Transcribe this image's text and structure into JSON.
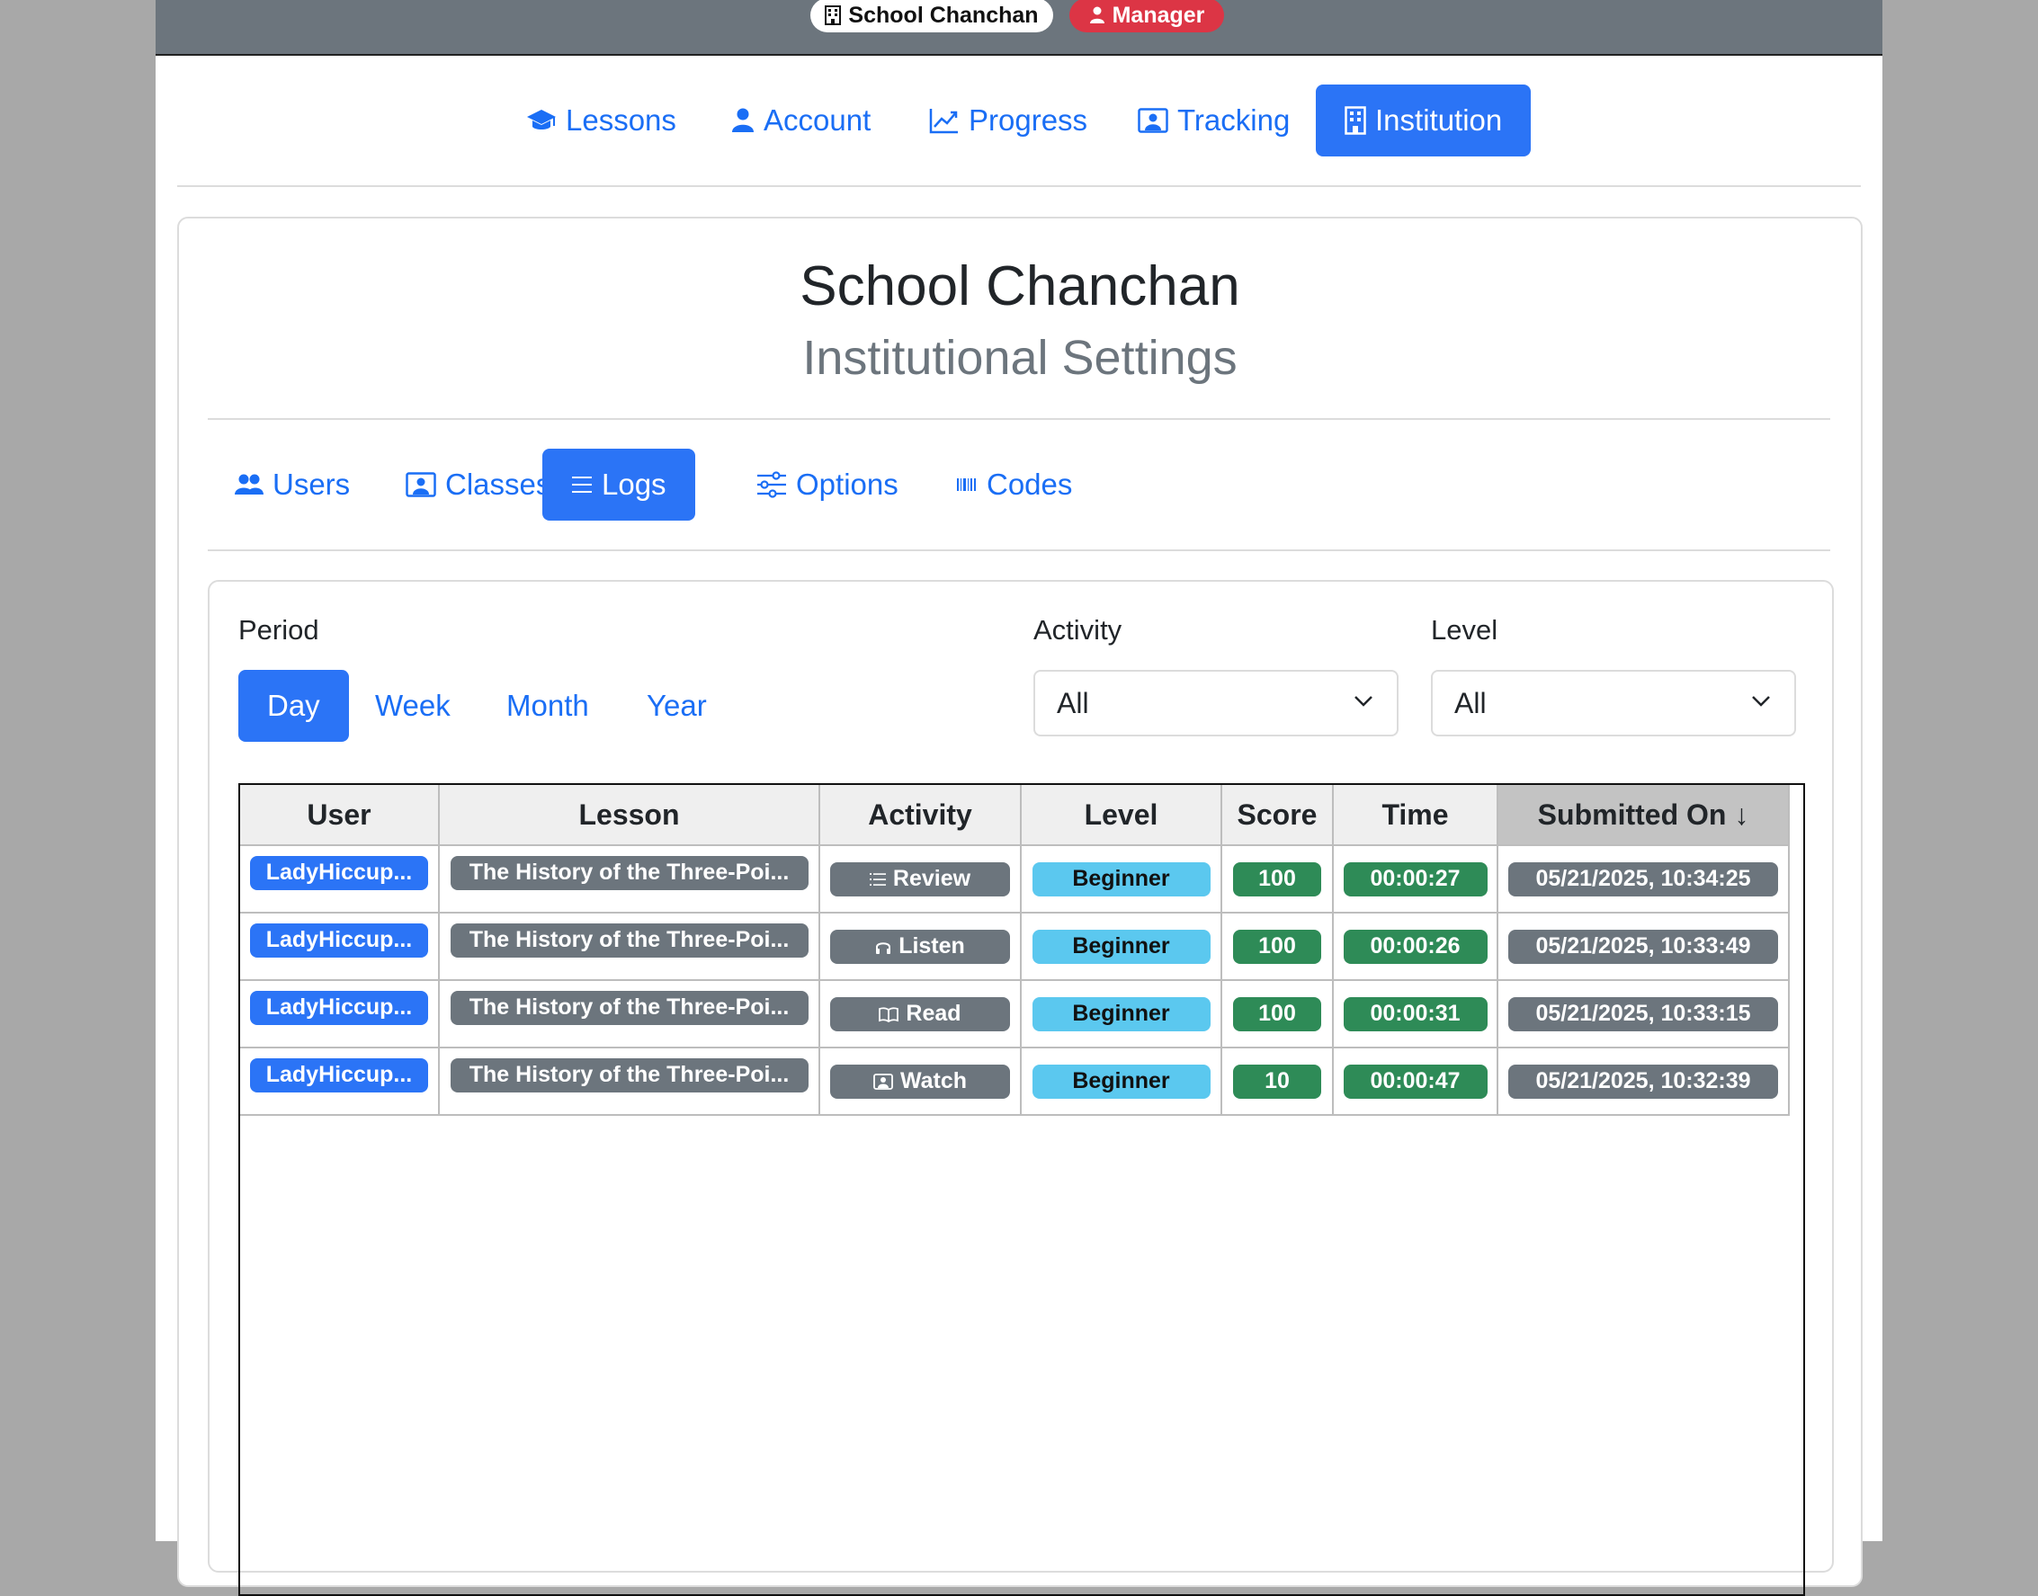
{
  "topbar": {
    "school": "School Chanchan",
    "role": "Manager"
  },
  "nav": {
    "lessons": "Lessons",
    "account": "Account",
    "progress": "Progress",
    "tracking": "Tracking",
    "institution": "Institution"
  },
  "header": {
    "title": "School Chanchan",
    "subtitle": "Institutional Settings"
  },
  "subnav": {
    "users": "Users",
    "classes": "Classes",
    "logs": "Logs",
    "options": "Options",
    "codes": "Codes"
  },
  "filters": {
    "period_label": "Period",
    "periods": [
      "Day",
      "Week",
      "Month",
      "Year"
    ],
    "activity_label": "Activity",
    "activity_value": "All",
    "level_label": "Level",
    "level_value": "All"
  },
  "table": {
    "headers": [
      "User",
      "Lesson",
      "Activity",
      "Level",
      "Score",
      "Time",
      "Submitted On ↓"
    ],
    "rows": [
      {
        "user": "LadyHiccup...",
        "lesson": "The History of the Three-Poi...",
        "activity": "Review",
        "activity_icon": "list-icon",
        "level": "Beginner",
        "score": "100",
        "time": "00:00:27",
        "submitted": "05/21/2025, 10:34:25"
      },
      {
        "user": "LadyHiccup...",
        "lesson": "The History of the Three-Poi...",
        "activity": "Listen",
        "activity_icon": "headphones-icon",
        "level": "Beginner",
        "score": "100",
        "time": "00:00:26",
        "submitted": "05/21/2025, 10:33:49"
      },
      {
        "user": "LadyHiccup...",
        "lesson": "The History of the Three-Poi...",
        "activity": "Read",
        "activity_icon": "book-icon",
        "level": "Beginner",
        "score": "100",
        "time": "00:00:31",
        "submitted": "05/21/2025, 10:33:15"
      },
      {
        "user": "LadyHiccup...",
        "lesson": "The History of the Three-Poi...",
        "activity": "Watch",
        "activity_icon": "video-icon",
        "level": "Beginner",
        "score": "10",
        "time": "00:00:47",
        "submitted": "05/21/2025, 10:32:39"
      }
    ]
  },
  "colors": {
    "primary": "#2b74f6",
    "secondary": "#6c757d",
    "danger": "#dc3545",
    "success": "#2e8b57",
    "info": "#5bc8ef"
  }
}
